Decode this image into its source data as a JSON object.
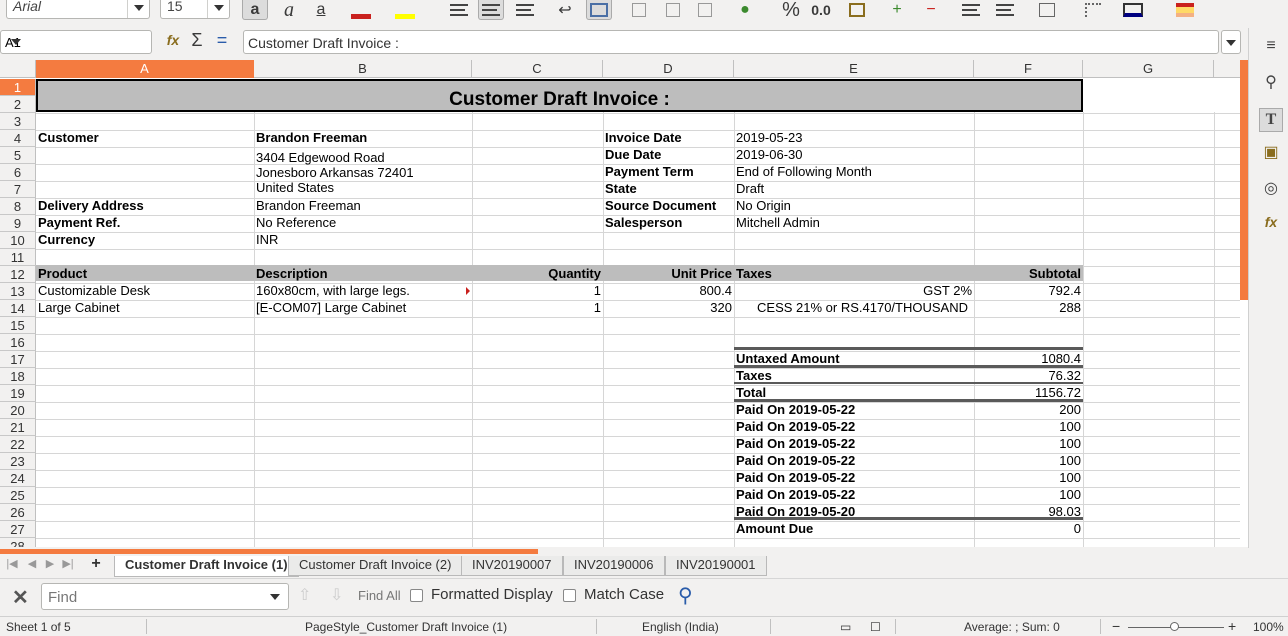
{
  "toolbar": {
    "font_name": "Arial",
    "font_size": "15",
    "percent_label": "%",
    "decimal_label": "0.0"
  },
  "formula_bar": {
    "cell_ref": "A1",
    "content": "Customer Draft Invoice :"
  },
  "columns": [
    "A",
    "B",
    "C",
    "D",
    "E",
    "F",
    "G"
  ],
  "rows": [
    "1",
    "2",
    "3",
    "4",
    "5",
    "6",
    "7",
    "8",
    "9",
    "10",
    "11",
    "12",
    "13",
    "14",
    "15",
    "16",
    "17",
    "18",
    "19",
    "20",
    "21",
    "22",
    "23",
    "24",
    "25",
    "26",
    "27",
    "28"
  ],
  "invoice": {
    "title": "Customer Draft Invoice :",
    "customer_label": "Customer",
    "customer_name": "Brandon Freeman",
    "address_line1": "3404  Edgewood Road",
    "address_line2": "Jonesboro Arkansas 72401",
    "address_line3": "United States",
    "delivery_label": "Delivery Address",
    "delivery_value": "Brandon Freeman",
    "payref_label": "Payment Ref.",
    "payref_value": "No Reference",
    "currency_label": "Currency",
    "currency_value": "INR",
    "invoice_date_label": "Invoice Date",
    "invoice_date_value": "2019-05-23",
    "due_date_label": "Due Date",
    "due_date_value": "2019-06-30",
    "payment_term_label": "Payment Term",
    "payment_term_value": "End of Following Month",
    "state_label": "State",
    "state_value": "Draft",
    "source_label": "Source Document",
    "source_value": "No Origin",
    "salesperson_label": "Salesperson",
    "salesperson_value": "Mitchell Admin",
    "lines_header": {
      "product": "Product",
      "description": "Description",
      "quantity": "Quantity",
      "unit_price": "Unit Price",
      "taxes": "Taxes",
      "subtotal": "Subtotal"
    },
    "lines": [
      {
        "product": "Customizable Desk",
        "description": "160x80cm, with large legs.",
        "quantity": "1",
        "unit_price": "800.4",
        "taxes": "GST 2%",
        "subtotal": "792.4"
      },
      {
        "product": "Large Cabinet",
        "description": "[E-COM07] Large Cabinet",
        "quantity": "1",
        "unit_price": "320",
        "taxes": "CESS 21% or RS.4170/THOUSAND",
        "subtotal": "288"
      }
    ],
    "totals": [
      {
        "label": "Untaxed Amount",
        "value": "1080.4"
      },
      {
        "label": "Taxes",
        "value": "76.32"
      },
      {
        "label": "Total",
        "value": "1156.72"
      },
      {
        "label": "Paid On 2019-05-22",
        "value": "200"
      },
      {
        "label": "Paid On 2019-05-22",
        "value": "100"
      },
      {
        "label": "Paid On 2019-05-22",
        "value": "100"
      },
      {
        "label": "Paid On 2019-05-22",
        "value": "100"
      },
      {
        "label": "Paid On 2019-05-22",
        "value": "100"
      },
      {
        "label": "Paid On 2019-05-22",
        "value": "100"
      },
      {
        "label": "Paid On 2019-05-20",
        "value": "98.03"
      },
      {
        "label": "Amount Due",
        "value": "0"
      }
    ]
  },
  "sheet_tabs": [
    "Customer Draft Invoice (1)",
    "Customer Draft Invoice (2)",
    "INV20190007",
    "INV20190006",
    "INV20190001"
  ],
  "find_bar": {
    "placeholder": "Find",
    "find_all": "Find All",
    "formatted_display": "Formatted Display",
    "match_case": "Match Case"
  },
  "status_bar": {
    "sheet": "Sheet 1 of 5",
    "page_style": "PageStyle_Customer Draft Invoice (1)",
    "language": "English (India)",
    "summary": "Average: ; Sum: 0",
    "zoom": "100%"
  },
  "colors": {
    "accent": "#f47b40",
    "header_fill": "#bdbdbd"
  }
}
